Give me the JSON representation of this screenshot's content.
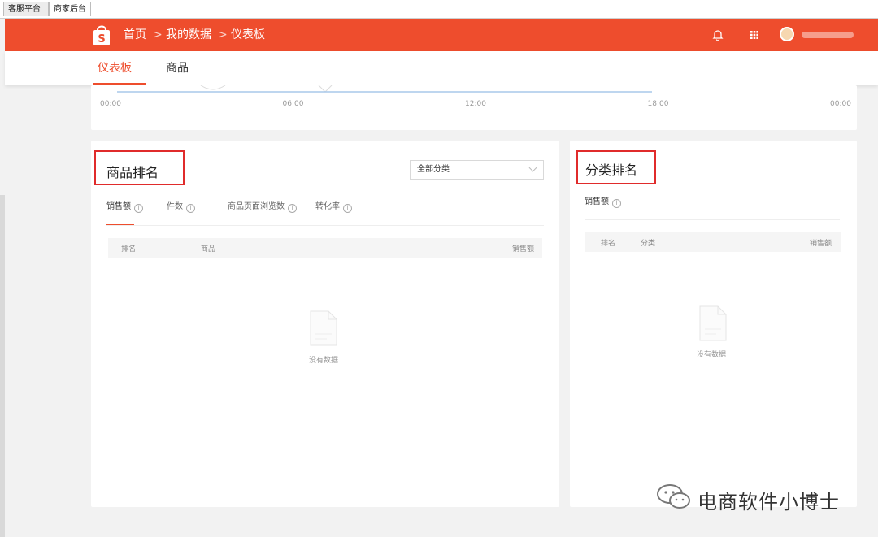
{
  "browser_tabs": [
    "客服平台",
    "商家后台"
  ],
  "header": {
    "breadcrumb": [
      "首页",
      "我的数据",
      "仪表板"
    ],
    "breadcrumb_separator": ">"
  },
  "subnav": {
    "tabs": [
      "仪表板",
      "商品"
    ],
    "active_tab": "仪表板"
  },
  "chart_data": {
    "type": "line",
    "x_ticks": [
      "00:00",
      "06:00",
      "12:00",
      "18:00",
      "00:00"
    ],
    "series": [],
    "grid": false
  },
  "product_ranking": {
    "title": "商品排名",
    "category_select": "全部分类",
    "metric_tabs": [
      "销售额",
      "件数",
      "商品页面浏览数",
      "转化率"
    ],
    "active_metric": "销售额",
    "columns": [
      "排名",
      "商品",
      "销售额"
    ],
    "empty_text": "没有数据"
  },
  "category_ranking": {
    "title": "分类排名",
    "metric_tabs": [
      "销售额"
    ],
    "active_metric": "销售额",
    "columns": [
      "排名",
      "分类",
      "销售额"
    ],
    "empty_text": "没有数据"
  },
  "watermark": {
    "text": "电商软件小博士"
  },
  "colors": {
    "brand": "#ee4d2d",
    "highlight_box": "#e02b2b"
  }
}
